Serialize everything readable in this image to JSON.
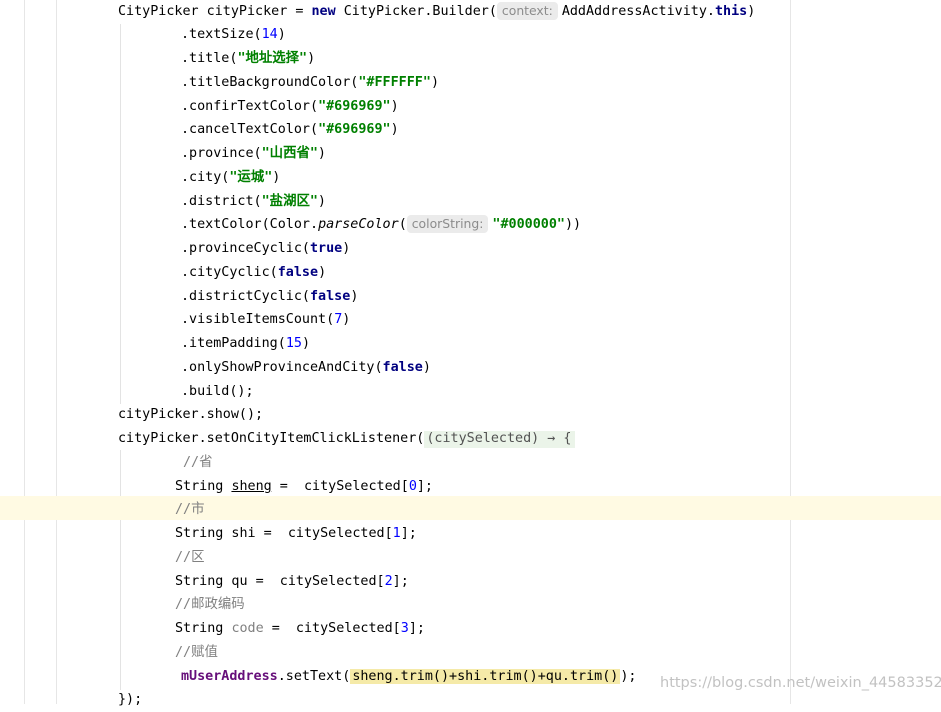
{
  "code": {
    "l1_a": "CityPicker cityPicker = ",
    "l1_new": "new",
    "l1_b": " CityPicker.Builder(",
    "l1_hint": "context:",
    "l1_c": "AddAddressActivity.",
    "l1_this": "this",
    "l1_d": ")",
    "m_textSize": ".textSize(",
    "v_textSize": "14",
    "m_title": ".title(",
    "v_title": "\"地址选择\"",
    "m_titleBg": ".titleBackgroundColor(",
    "v_titleBg": "\"#FFFFFF\"",
    "m_confir": ".confirTextColor(",
    "v_confir": "\"#696969\"",
    "m_cancel": ".cancelTextColor(",
    "v_cancel": "\"#696969\"",
    "m_province": ".province(",
    "v_province": "\"山西省\"",
    "m_city": ".city(",
    "v_city": "\"运城\"",
    "m_district": ".district(",
    "v_district": "\"盐湖区\"",
    "m_textColor_a": ".textColor(Color.",
    "m_textColor_parse": "parseColor",
    "m_textColor_b": "(",
    "hint_colorString": "colorString:",
    "v_textColor": "\"#000000\"",
    "close2": "))",
    "close1": ")",
    "m_provinceCyclic": ".provinceCyclic(",
    "v_true": "true",
    "m_cityCyclic": ".cityCyclic(",
    "v_false": "false",
    "m_districtCyclic": ".districtCyclic(",
    "m_visible": ".visibleItemsCount(",
    "v_visible": "7",
    "m_itemPadding": ".itemPadding(",
    "v_itemPadding": "15",
    "m_onlyShow": ".onlyShowProvinceAndCity(",
    "m_build": ".build();",
    "show": "cityPicker.show();",
    "listener_a": "cityPicker.setOnCityItemClickListener(",
    "listener_lambda": "(citySelected) → {",
    "cmt_sheng": "//省",
    "sheng_a": "String ",
    "sheng_var": "sheng",
    "sheng_b": " =  citySelected[",
    "idx0": "0",
    "bracket_end": "];",
    "cmt_shi": "//市",
    "shi_a": "String shi =  citySelected[",
    "idx1": "1",
    "cmt_qu": "//区",
    "qu_a": "String qu =  citySelected[",
    "idx2": "2",
    "cmt_code": "//邮政编码",
    "code_a": "String ",
    "code_var": "code",
    "code_b": " =  citySelected[",
    "idx3": "3",
    "cmt_assign": "//赋值",
    "assign_field": "mUserAddress",
    "assign_a": ".setText(",
    "assign_sel": "sheng.trim()+shi.trim()+qu.trim()",
    "assign_b": ");",
    "end": "});"
  },
  "watermark": "https://blog.csdn.net/weixin_44583352"
}
